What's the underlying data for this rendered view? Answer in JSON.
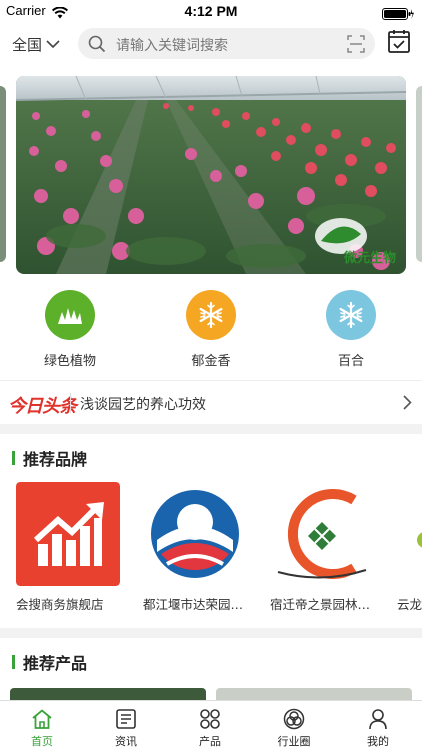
{
  "status_bar": {
    "carrier": "Carrier",
    "time": "4:12 PM"
  },
  "header": {
    "region": "全国",
    "search_placeholder": "请输入关键词搜索"
  },
  "banner": {
    "logo_text": "微元生物"
  },
  "categories": [
    {
      "label": "绿色植物",
      "color": "#5db02a",
      "icon": "grass-icon"
    },
    {
      "label": "郁金香",
      "color": "#f5a623",
      "icon": "snowflake-icon"
    },
    {
      "label": "百合",
      "color": "#7cc6e0",
      "icon": "snowflake-icon"
    }
  ],
  "news": {
    "source": "今日头条",
    "headline": "浅谈园艺的养心功效"
  },
  "brands_section": {
    "title": "推荐品牌",
    "items": [
      {
        "name": "会搜商务旗舰店"
      },
      {
        "name": "都江堰市达荣园…"
      },
      {
        "name": "宿迁帝之景园林…"
      },
      {
        "name": "云龙"
      }
    ]
  },
  "products_section": {
    "title": "推荐产品"
  },
  "tabbar": {
    "items": [
      {
        "label": "首页",
        "icon": "home-icon",
        "active": true
      },
      {
        "label": "资讯",
        "icon": "news-icon",
        "active": false
      },
      {
        "label": "产品",
        "icon": "grid-icon",
        "active": false
      },
      {
        "label": "行业圈",
        "icon": "circles-icon",
        "active": false
      },
      {
        "label": "我的",
        "icon": "user-icon",
        "active": false
      }
    ]
  },
  "colors": {
    "accent": "#3aa23a",
    "headline_red": "#e0322b"
  }
}
